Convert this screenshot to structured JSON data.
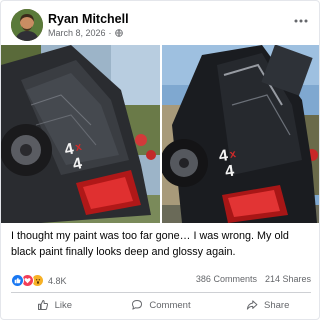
{
  "post": {
    "author": "Ryan Mitchell",
    "date": "March 8, 2026",
    "date_separator": "·",
    "privacy_icon": "globe-icon",
    "more_icon": "more-horizontal-icon",
    "caption": "I thought my paint was too far gone… I was wrong. My old black paint finally looks deep and glossy again.",
    "photos": [
      {
        "badge": "4x4"
      },
      {
        "badge": "4x4"
      }
    ]
  },
  "stats": {
    "reaction_icons": [
      "like-reaction-icon",
      "love-reaction-icon",
      "wow-reaction-icon"
    ],
    "reaction_count": "4.8K",
    "comments": "386 Comments",
    "shares": "214 Shares"
  },
  "actions": {
    "like": "Like",
    "comment": "Comment",
    "share": "Share"
  },
  "colors": {
    "accent": "#1877f2",
    "love": "#f33e58",
    "wow": "#f7b125",
    "secondary_text": "#65676b"
  }
}
